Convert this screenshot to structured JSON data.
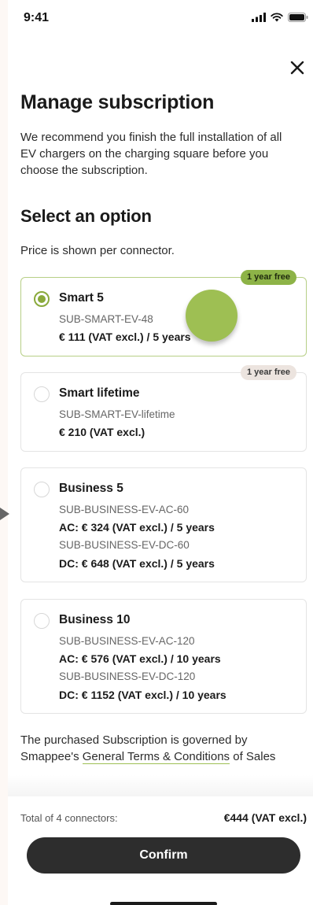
{
  "status_bar": {
    "time": "9:41"
  },
  "header": {
    "title": "Manage subscription",
    "intro": "We recommend you finish the full installation of all EV chargers on the charging square before you choose the subscription."
  },
  "options_section": {
    "title": "Select an option",
    "price_note": "Price is shown per connector."
  },
  "options": [
    {
      "name": "Smart 5",
      "selected": true,
      "badge": "1 year free",
      "lines": [
        {
          "text": "SUB-SMART-EV-48",
          "price": false
        },
        {
          "text": "€ 111 (VAT excl.) / 5 years",
          "price": true
        }
      ]
    },
    {
      "name": "Smart lifetime",
      "selected": false,
      "badge": "1 year free",
      "lines": [
        {
          "text": "SUB-SMART-EV-lifetime",
          "price": false
        },
        {
          "text": "€ 210 (VAT excl.)",
          "price": true
        }
      ]
    },
    {
      "name": "Business 5",
      "selected": false,
      "badge": null,
      "lines": [
        {
          "text": "SUB-BUSINESS-EV-AC-60",
          "price": false
        },
        {
          "text": "AC: € 324 (VAT excl.) / 5 years",
          "price": true
        },
        {
          "text": "SUB-BUSINESS-EV-DC-60",
          "price": false
        },
        {
          "text": "DC: € 648 (VAT excl.) / 5 years",
          "price": true
        }
      ]
    },
    {
      "name": "Business 10",
      "selected": false,
      "badge": null,
      "lines": [
        {
          "text": "SUB-BUSINESS-EV-AC-120",
          "price": false
        },
        {
          "text": "AC: € 576 (VAT excl.) / 10 years",
          "price": true
        },
        {
          "text": "SUB-BUSINESS-EV-DC-120",
          "price": false
        },
        {
          "text": "DC: € 1152 (VAT excl.) / 10 years",
          "price": true
        }
      ]
    }
  ],
  "terms": {
    "before": "The purchased Subscription is governed by Smappee's ",
    "link": "General Terms & Conditions",
    "after": " of Sales"
  },
  "footer": {
    "total_label": "Total of 4 connectors:",
    "total_value": "€444 (VAT excl.)",
    "confirm_label": "Confirm"
  },
  "colors": {
    "accent_green": "#8db347",
    "badge_beige": "#ece4df",
    "button_dark": "#2d2d2d"
  },
  "icons": [
    "signal-icon",
    "wifi-icon",
    "battery-icon",
    "close-icon"
  ]
}
